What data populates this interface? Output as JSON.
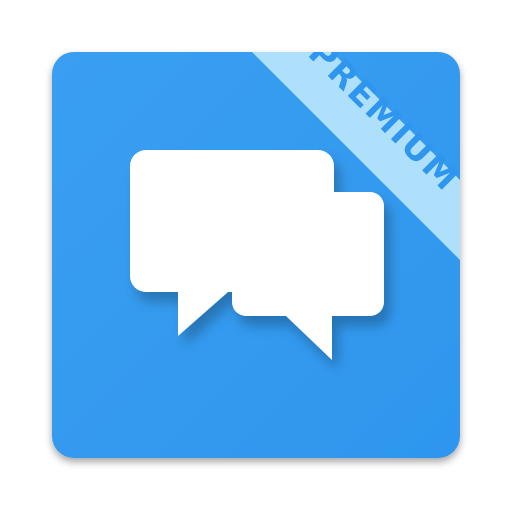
{
  "app_icon": {
    "ribbon_label": "PREMIUM",
    "colors": {
      "tile": "#2e96ee",
      "tile_light": "#3a9ff0",
      "ribbon": "#aee0fb",
      "ribbon_text": "#2e96ee",
      "bubble": "#ffffff"
    },
    "icons": [
      "app-tile",
      "speech-bubbles-icon"
    ]
  }
}
